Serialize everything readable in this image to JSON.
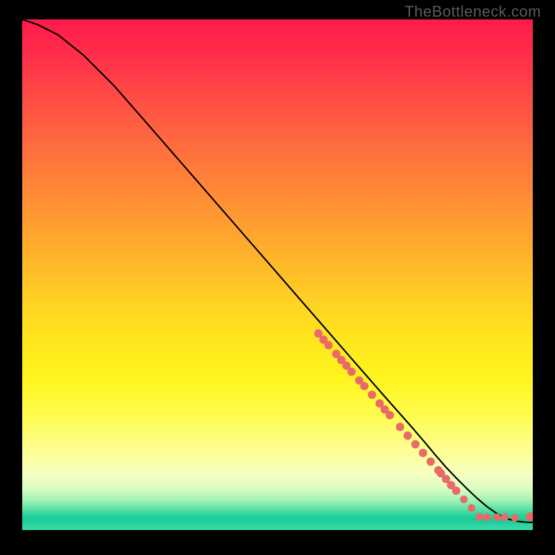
{
  "watermark": "TheBottleneck.com",
  "chart_data": {
    "type": "line",
    "title": "",
    "xlabel": "",
    "ylabel": "",
    "xlim": [
      0,
      100
    ],
    "ylim": [
      0,
      100
    ],
    "line": {
      "name": "curve",
      "x": [
        0,
        3,
        7,
        12,
        18,
        25,
        35,
        45,
        55,
        65,
        72,
        76,
        79,
        81,
        83,
        85,
        87,
        89,
        91,
        93,
        95,
        97,
        99,
        100
      ],
      "y": [
        100,
        99,
        97,
        93,
        87,
        79,
        67.5,
        56,
        44.5,
        33,
        25,
        20.5,
        17,
        14.6,
        12.3,
        10.2,
        8.2,
        6.3,
        4.6,
        3.2,
        2.2,
        1.7,
        1.5,
        1.5
      ]
    },
    "points": {
      "name": "highlight-markers",
      "color": "#e86a6a",
      "x": [
        58,
        59,
        60,
        61.5,
        62.5,
        63.5,
        64.5,
        66,
        67,
        68.5,
        70,
        71,
        72,
        74,
        75.5,
        77,
        78.5,
        80,
        81.5,
        82,
        83,
        84,
        85,
        86.5,
        88,
        89.5,
        91,
        93,
        94.5,
        96.5,
        99.5
      ],
      "y": [
        38.5,
        37.3,
        36.2,
        34.5,
        33.3,
        32.2,
        31.0,
        29.3,
        28.2,
        26.5,
        24.8,
        23.6,
        22.5,
        20.2,
        18.5,
        16.8,
        15.1,
        13.4,
        11.7,
        11.1,
        10.0,
        8.8,
        7.7,
        6.0,
        4.3,
        2.6,
        2.5,
        2.5,
        2.5,
        2.4,
        2.6
      ],
      "r": [
        6,
        6,
        6,
        6,
        6,
        6,
        6,
        6,
        6,
        6,
        6,
        6,
        6,
        6,
        6,
        6,
        6,
        6,
        6,
        6,
        6,
        6,
        6,
        5.5,
        5.5,
        5.5,
        5.5,
        5.5,
        5.5,
        5.5,
        6.5
      ]
    }
  }
}
